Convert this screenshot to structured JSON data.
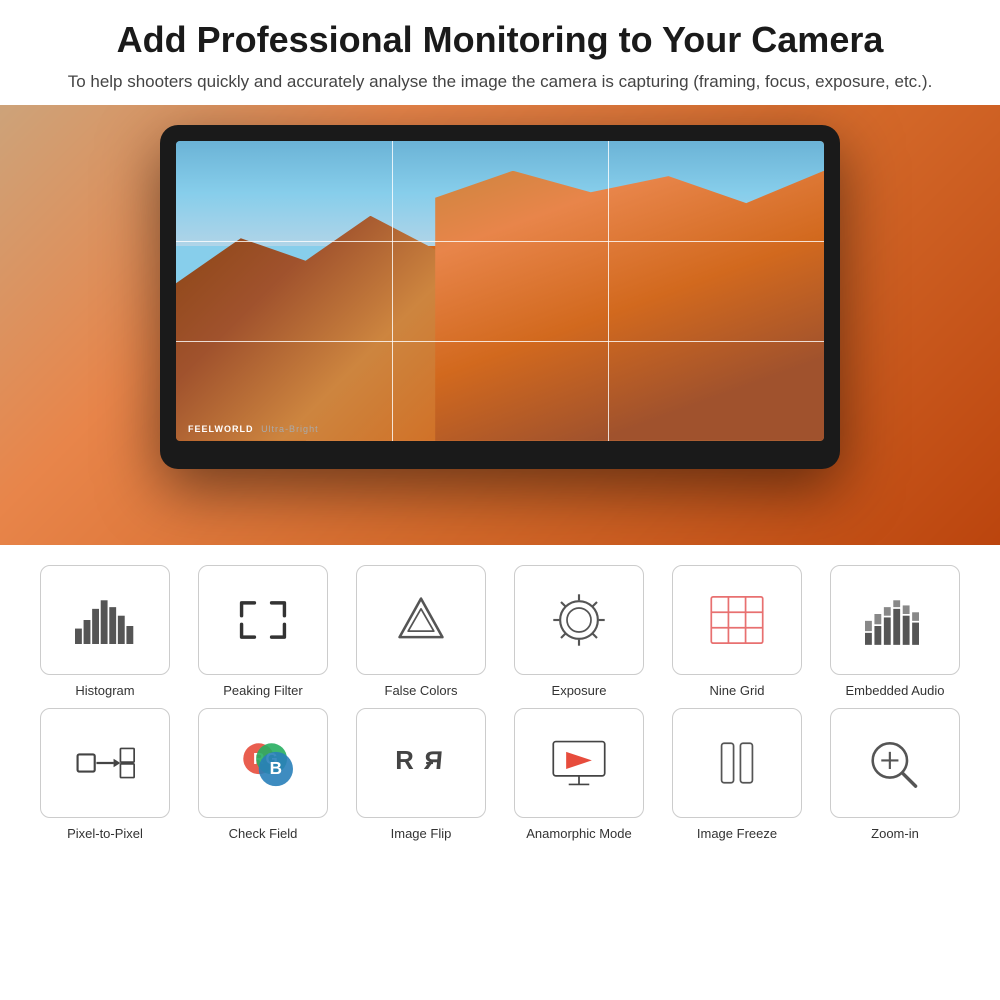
{
  "header": {
    "title": "Add Professional Monitoring to Your Camera",
    "subtitle": "To help shooters quickly and accurately analyse the image the camera is capturing (framing, focus, exposure, etc.)."
  },
  "monitor": {
    "brand": "FEELWORLD",
    "model": "Ultra-Bright"
  },
  "features": [
    {
      "id": "histogram",
      "label": "Histogram",
      "icon_type": "histogram"
    },
    {
      "id": "peaking-filter",
      "label": "Peaking Filter",
      "icon_type": "peaking"
    },
    {
      "id": "false-colors",
      "label": "False Colors",
      "icon_type": "false-colors"
    },
    {
      "id": "exposure",
      "label": "Exposure",
      "icon_type": "exposure"
    },
    {
      "id": "nine-grid",
      "label": "Nine Grid",
      "icon_type": "nine-grid"
    },
    {
      "id": "embedded-audio",
      "label": "Embedded Audio",
      "icon_type": "audio"
    },
    {
      "id": "pixel-to-pixel",
      "label": "Pixel-to-Pixel",
      "icon_type": "pixel"
    },
    {
      "id": "check-field",
      "label": "Check Field",
      "icon_type": "check-field"
    },
    {
      "id": "image-flip",
      "label": "Image Flip",
      "icon_type": "flip"
    },
    {
      "id": "anamorphic-mode",
      "label": "Anamorphic Mode",
      "icon_type": "anamorphic"
    },
    {
      "id": "image-freeze",
      "label": "Image Freeze",
      "icon_type": "freeze"
    },
    {
      "id": "zoom-in",
      "label": "Zoom-in",
      "icon_type": "zoom"
    }
  ]
}
